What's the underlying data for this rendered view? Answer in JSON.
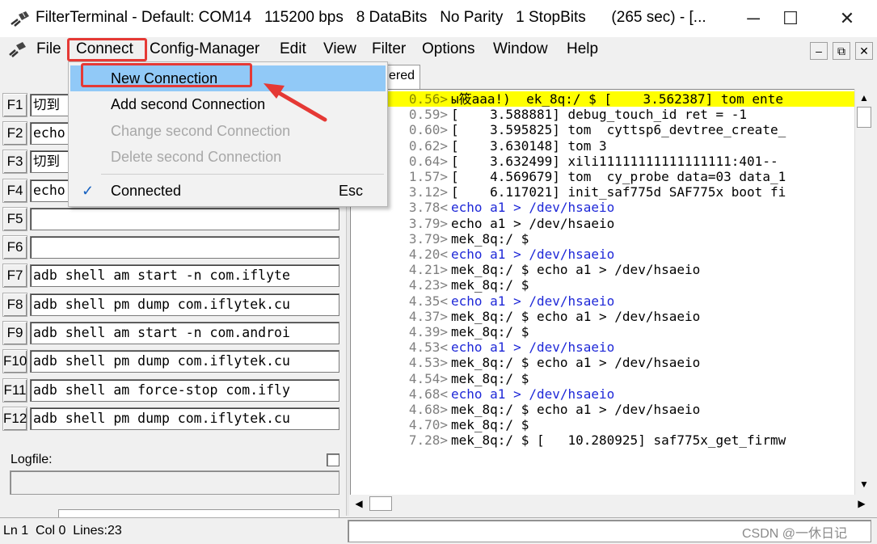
{
  "window": {
    "title": "FilterTerminal - Default: COM14   115200 bps   8 DataBits   No Parity   1 StopBits      (265 sec) - [...",
    "controls": {
      "minimize": "─",
      "maximize": "☐",
      "close": "✕"
    }
  },
  "menubar": {
    "items": [
      "File",
      "Connect",
      "Config-Manager",
      "Edit",
      "View",
      "Filter",
      "Options",
      "Window",
      "Help"
    ],
    "mdi_controls": {
      "minimize": "–",
      "restore": "⧉",
      "close": "✕"
    }
  },
  "connect_menu": {
    "items": [
      {
        "label": "New Connection",
        "state": "selected"
      },
      {
        "label": "Add second Connection",
        "state": "enabled"
      },
      {
        "label": "Change second Connection",
        "state": "disabled"
      },
      {
        "label": "Delete second Connection",
        "state": "disabled"
      },
      {
        "label": "Connected",
        "state": "checked",
        "check": "✓",
        "shortcut": "Esc"
      }
    ]
  },
  "function_keys": [
    {
      "key": "F1",
      "value": "切到"
    },
    {
      "key": "F2",
      "value": "echo"
    },
    {
      "key": "F3",
      "value": "切到"
    },
    {
      "key": "F4",
      "value": "echo"
    },
    {
      "key": "F5",
      "value": ""
    },
    {
      "key": "F6",
      "value": ""
    },
    {
      "key": "F7",
      "value": "adb shell am start -n com.iflyte"
    },
    {
      "key": "F8",
      "value": "adb shell pm dump com.iflytek.cu"
    },
    {
      "key": "F9",
      "value": "adb shell am start -n com.androi"
    },
    {
      "key": "F10",
      "value": "adb shell pm dump com.iflytek.cu"
    },
    {
      "key": "F11",
      "value": "adb shell am force-stop com.ifly"
    },
    {
      "key": "F12",
      "value": "adb shell pm dump com.iflytek.cu"
    }
  ],
  "logfile": {
    "label": "Logfile:"
  },
  "terminal": {
    "tab_label": "ered",
    "lines": [
      {
        "ts": "0.56>",
        "text": "ы筱aaa!)  ek_8q:/ $ [    3.562387] tom ente",
        "style": "highlight"
      },
      {
        "ts": "0.59>",
        "text": "[    3.588881] debug_touch_id ret = -1",
        "style": "normal"
      },
      {
        "ts": "0.60>",
        "text": "[    3.595825] tom  cyttsp6_devtree_create_",
        "style": "normal"
      },
      {
        "ts": "0.62>",
        "text": "[    3.630148] tom 3",
        "style": "normal"
      },
      {
        "ts": "0.64>",
        "text": "[    3.632499] xili11111111111111111:401--",
        "style": "normal"
      },
      {
        "ts": "1.57>",
        "text": "[    4.569679] tom  cy_probe data=03 data_1",
        "style": "normal"
      },
      {
        "ts": "3.12>",
        "text": "[    6.117021] init_saf775d SAF775x boot fi",
        "style": "normal"
      },
      {
        "ts": "3.78<",
        "text": "echo a1 > /dev/hsaeio",
        "style": "blue"
      },
      {
        "ts": "3.79>",
        "text": "echo a1 > /dev/hsaeio",
        "style": "normal"
      },
      {
        "ts": "3.79>",
        "text": "mek_8q:/ $",
        "style": "normal"
      },
      {
        "ts": "4.20<",
        "text": "echo a1 > /dev/hsaeio",
        "style": "blue"
      },
      {
        "ts": "4.21>",
        "text": "mek_8q:/ $ echo a1 > /dev/hsaeio",
        "style": "normal"
      },
      {
        "ts": "4.23>",
        "text": "mek_8q:/ $",
        "style": "normal"
      },
      {
        "ts": "4.35<",
        "text": "echo a1 > /dev/hsaeio",
        "style": "blue"
      },
      {
        "ts": "4.37>",
        "text": "mek_8q:/ $ echo a1 > /dev/hsaeio",
        "style": "normal"
      },
      {
        "ts": "4.39>",
        "text": "mek_8q:/ $",
        "style": "normal"
      },
      {
        "ts": "4.53<",
        "text": "echo a1 > /dev/hsaeio",
        "style": "blue"
      },
      {
        "ts": "4.53>",
        "text": "mek_8q:/ $ echo a1 > /dev/hsaeio",
        "style": "normal"
      },
      {
        "ts": "4.54>",
        "text": "mek_8q:/ $",
        "style": "normal"
      },
      {
        "ts": "4.68<",
        "text": "echo a1 > /dev/hsaeio",
        "style": "blue"
      },
      {
        "ts": "4.68>",
        "text": "mek_8q:/ $ echo a1 > /dev/hsaeio",
        "style": "normal"
      },
      {
        "ts": "4.70>",
        "text": "mek_8q:/ $",
        "style": "normal"
      },
      {
        "ts": "7.28>",
        "text": "mek_8q:/ $ [   10.280925] saf775x_get_firmw",
        "style": "normal"
      }
    ]
  },
  "statusbar": {
    "text": "Ln 1  Col 0  Lines:23"
  },
  "watermark": "CSDN @一休日记",
  "colors": {
    "highlight": "#ffff00",
    "sent_text": "#1e28d8",
    "annotation": "#e53935",
    "menu_selection": "#91c9f7"
  }
}
